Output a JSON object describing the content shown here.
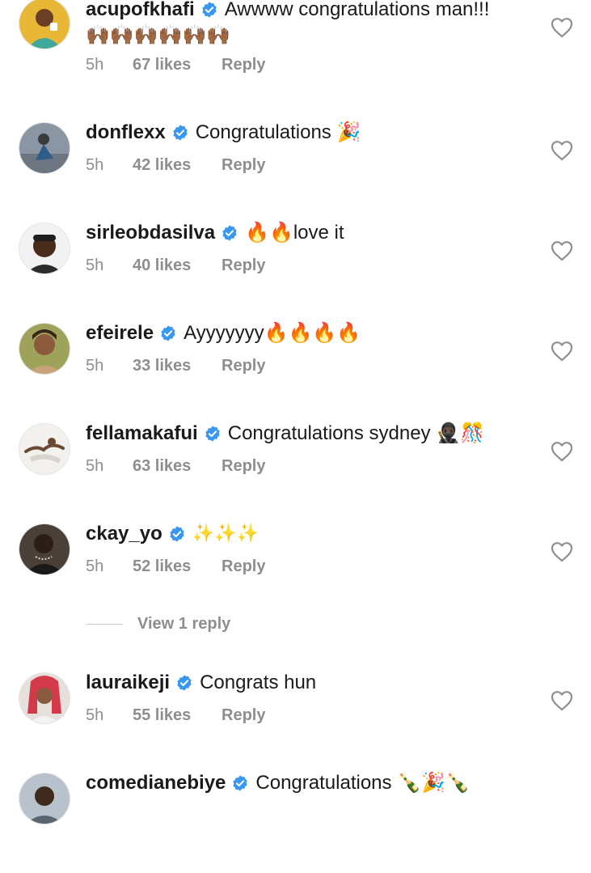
{
  "comments": [
    {
      "username": "acupofkhafi",
      "text": "Awwww congratulations man!!!",
      "second_line": "🙌🏾🙌🏾🙌🏾🙌🏾🙌🏾🙌🏾",
      "time": "5h",
      "likes": "67 likes",
      "reply": "Reply",
      "avatar_bg": "#e8b735",
      "avatar_skin": "#6b3f26",
      "avatar_shirt": "#3fa89a"
    },
    {
      "username": "donflexx",
      "text": "Congratulations 🎉",
      "time": "5h",
      "likes": "42 likes",
      "reply": "Reply",
      "avatar_bg": "#8a96a3",
      "avatar_skin": "#3b3b3b",
      "avatar_shirt": "#2f5d8a"
    },
    {
      "username": "sirleobdasilva",
      "text": "🔥🔥love it",
      "time": "5h",
      "likes": "40 likes",
      "reply": "Reply",
      "avatar_bg": "#f2f2f2",
      "avatar_skin": "#4a2c1c",
      "avatar_shirt": "#2b2b2b"
    },
    {
      "username": "efeirele",
      "text": "Ayyyyyyy🔥🔥🔥🔥",
      "time": "5h",
      "likes": "33 likes",
      "reply": "Reply",
      "avatar_bg": "#9da35a",
      "avatar_skin": "#8a5a3a",
      "avatar_shirt": "#c9a27a"
    },
    {
      "username": "fellamakafui",
      "text": "Congratulations sydney 🥷🏿🎊",
      "time": "5h",
      "likes": "63 likes",
      "reply": "Reply",
      "avatar_bg": "#f3f1ee",
      "avatar_skin": "#6b4a34",
      "avatar_shirt": "#d9d4cc"
    },
    {
      "username": "ckay_yo",
      "text": "✨✨✨",
      "time": "5h",
      "likes": "52 likes",
      "reply": "Reply",
      "avatar_bg": "#4a4038",
      "avatar_skin": "#2b1e17",
      "avatar_shirt": "#1a1a1a"
    },
    {
      "username": "lauraikeji",
      "text": "Congrats hun",
      "time": "5h",
      "likes": "55 likes",
      "reply": "Reply",
      "avatar_bg": "#e6e0dc",
      "avatar_skin": "#8a5a3e",
      "avatar_shirt": "#d23a4a"
    },
    {
      "username": "comedianebiye",
      "text": "Congratulations 🍾🎉🍾",
      "time": "",
      "likes": "",
      "reply": "",
      "avatar_bg": "#b8c2cc",
      "avatar_skin": "#3e2a1e",
      "avatar_shirt": "#5a6570"
    }
  ],
  "view_replies": {
    "label": "View 1 reply"
  },
  "colors": {
    "verified": "#3897f0",
    "meta": "#8e8e8e",
    "heart_stroke": "#8e8e8e"
  },
  "icons": {
    "verified": "verified-badge-icon",
    "like": "heart-outline-icon"
  }
}
